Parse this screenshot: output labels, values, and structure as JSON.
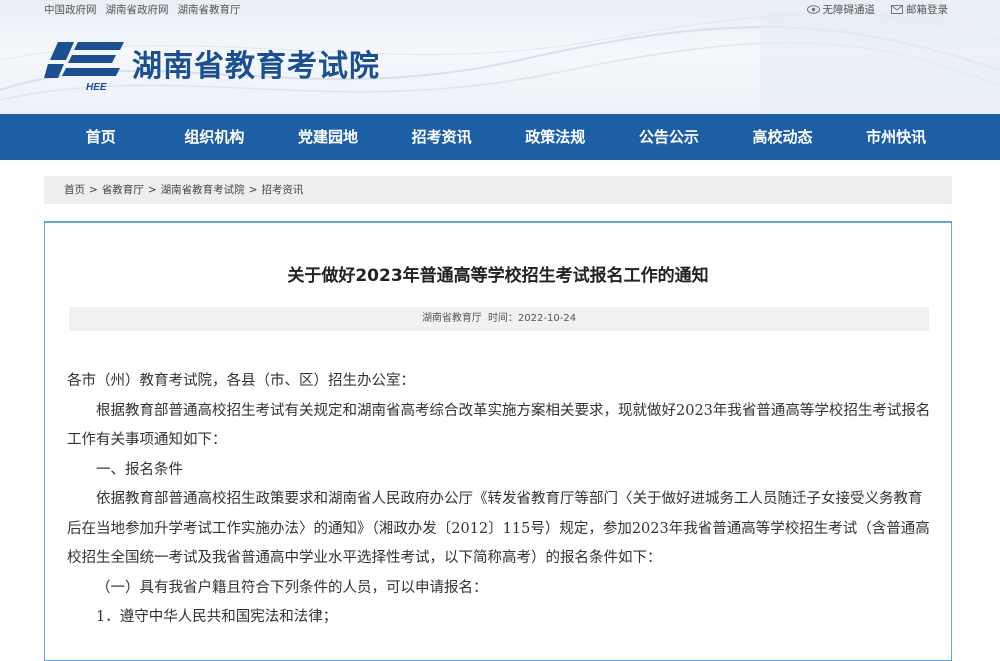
{
  "top_links": [
    "中国政府网",
    "湖南省政府网",
    "湖南省教育厅"
  ],
  "top_right": {
    "accessibility": "无障碍通道",
    "mail_login": "邮箱登录"
  },
  "site": {
    "logo_text": "HEE",
    "title": "湖南省教育考试院"
  },
  "nav": {
    "items": [
      "首页",
      "组织机构",
      "党建园地",
      "招考资讯",
      "政策法规",
      "公告公示",
      "高校动态",
      "市州快讯"
    ]
  },
  "breadcrumb": {
    "items": [
      "首页",
      "省教育厅",
      "湖南省教育考试院",
      "招考资讯"
    ],
    "separator": ">"
  },
  "article": {
    "title": "关于做好2023年普通高等学校招生考试报名工作的通知",
    "source": "湖南省教育厅",
    "time_label": "时间：",
    "time": "2022-10-24",
    "paragraphs": [
      "各市（州）教育考试院，各县（市、区）招生办公室：",
      "根据教育部普通高校招生考试有关规定和湖南省高考综合改革实施方案相关要求，现就做好2023年我省普通高等学校招生考试报名工作有关事项通知如下：",
      "一、报名条件",
      "依据教育部普通高校招生政策要求和湖南省人民政府办公厅《转发省教育厅等部门〈关于做好进城务工人员随迁子女接受义务教育后在当地参加升学考试工作实施办法〉的通知》（湘政办发〔2012〕115号）规定，参加2023年我省普通高等学校招生考试（含普通高校招生全国统一考试及我省普通高中学业水平选择性考试，以下简称高考）的报名条件如下：",
      "（一）具有我省户籍且符合下列条件的人员，可以申请报名：",
      "1．遵守中华人民共和国宪法和法律；"
    ]
  },
  "colors": {
    "nav_bg": "#1e5ea4",
    "title_blue": "#1b4f8f",
    "panel_border": "#5ea8d8"
  }
}
